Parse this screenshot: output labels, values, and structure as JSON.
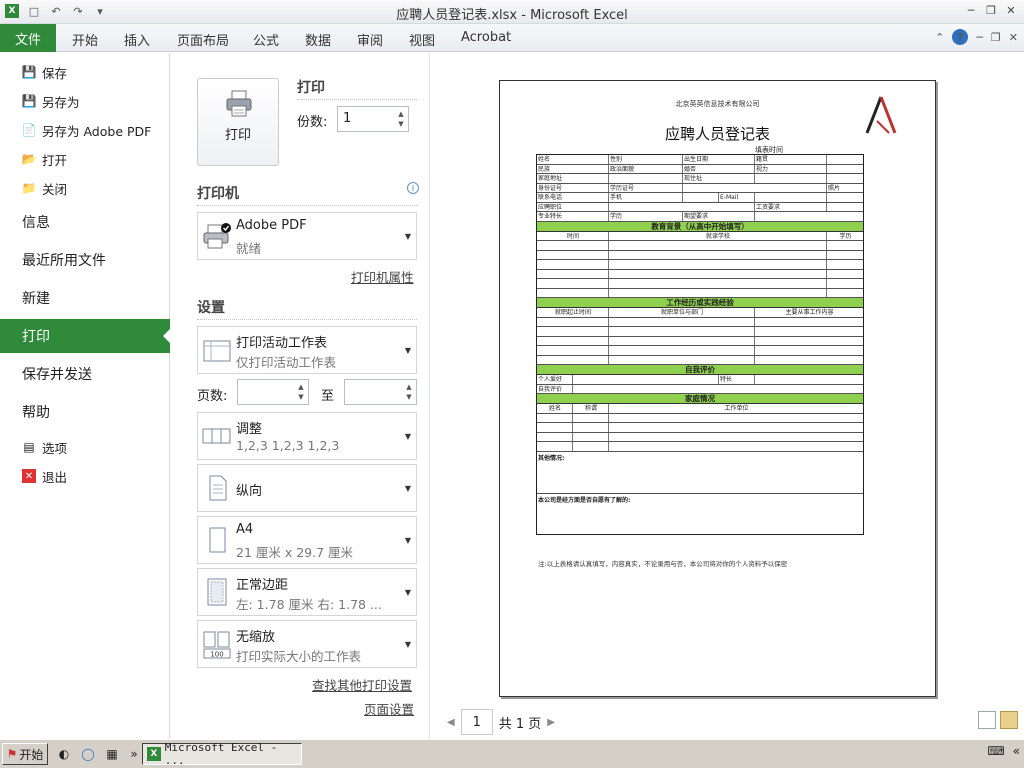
{
  "window": {
    "title": "应聘人员登记表.xlsx  -  Microsoft Excel"
  },
  "ribbon": {
    "file_tab": "文件",
    "tabs": [
      "开始",
      "插入",
      "页面布局",
      "公式",
      "数据",
      "审阅",
      "视图",
      "Acrobat"
    ]
  },
  "backstage": {
    "small_items": [
      {
        "label": "保存",
        "icon": "save-icon"
      },
      {
        "label": "另存为",
        "icon": "save-as-icon"
      },
      {
        "label": "另存为 Adobe PDF",
        "icon": "pdf-icon"
      },
      {
        "label": "打开",
        "icon": "open-folder-icon"
      },
      {
        "label": "关闭",
        "icon": "close-folder-icon"
      }
    ],
    "big_items": [
      "信息",
      "最近所用文件",
      "新建",
      "打印",
      "保存并发送",
      "帮助"
    ],
    "bottom_items": [
      {
        "label": "选项",
        "icon": "options-icon"
      },
      {
        "label": "退出",
        "icon": "exit-icon"
      }
    ]
  },
  "print": {
    "section_title": "打印",
    "button_label": "打印",
    "copies_label": "份数:",
    "copies_value": "1",
    "printer_title": "打印机",
    "printer_name": "Adobe PDF",
    "printer_status": "就绪",
    "printer_props_link": "打印机属性",
    "settings_title": "设置",
    "pages_label": "页数:",
    "pages_to": "至",
    "settings": [
      {
        "l1": "打印活动工作表",
        "l2": "仅打印活动工作表",
        "icon": "sheet-icon"
      },
      {
        "l1": "调整",
        "l2": "1,2,3    1,2,3    1,2,3",
        "icon": "collate-icon"
      },
      {
        "l1": "纵向",
        "l2": "",
        "icon": "portrait-icon"
      },
      {
        "l1": "A4",
        "l2": "21 厘米 x 29.7 厘米",
        "icon": "paper-size-icon"
      },
      {
        "l1": "正常边距",
        "l2": "左:  1.78 厘米     右:  1.78 ...",
        "icon": "margins-icon"
      },
      {
        "l1": "无缩放",
        "l2": "打印实际大小的工作表",
        "icon": "no-scaling-icon"
      }
    ],
    "more_settings_link": "查找其他打印设置",
    "page_setup_link": "页面设置"
  },
  "preview": {
    "company": "北京英英信息技术有限公司",
    "title": "应聘人员登记表",
    "date_label": "填表时间",
    "sections": [
      "教育背景（从高中开始填写）",
      "工作经历或实践经验",
      "自我评价",
      "家庭情况"
    ],
    "edu_headers": [
      "时间",
      "就读学校",
      "学历"
    ],
    "work_headers": [
      "就职起止时间",
      "就职单位与部门",
      "主要从事工作内容"
    ],
    "self_rows": [
      "个人爱好",
      "自我评价"
    ],
    "self_extra": "特长",
    "family_headers": [
      "姓名",
      "称谓",
      "工作单位"
    ],
    "personal_rows": [
      [
        "姓名",
        "性别",
        "出生日期",
        "籍贯"
      ],
      [
        "民族",
        "政治面貌",
        "婚否",
        "视力"
      ],
      [
        "家庭地址",
        "",
        "现住址",
        ""
      ],
      [
        "身份证号",
        "学历证号",
        "",
        "照片"
      ],
      [
        "联系电话",
        "手机",
        "E-Mail",
        ""
      ],
      [
        "应聘职位",
        "",
        "工资要求",
        ""
      ],
      [
        "专业特长",
        "学历",
        "期望要求",
        ""
      ]
    ],
    "other_label": "其他情况:",
    "source_label": "本公司是经方面是否自愿有了解的:",
    "note": "注:以上表格请认真填写，内容真实，不论录用与否，本公司将对你的个人资料予以保密",
    "page_current": "1",
    "page_total": "共 1 页"
  },
  "taskbar": {
    "start": "开始",
    "app": "Microsoft Excel - ..."
  }
}
